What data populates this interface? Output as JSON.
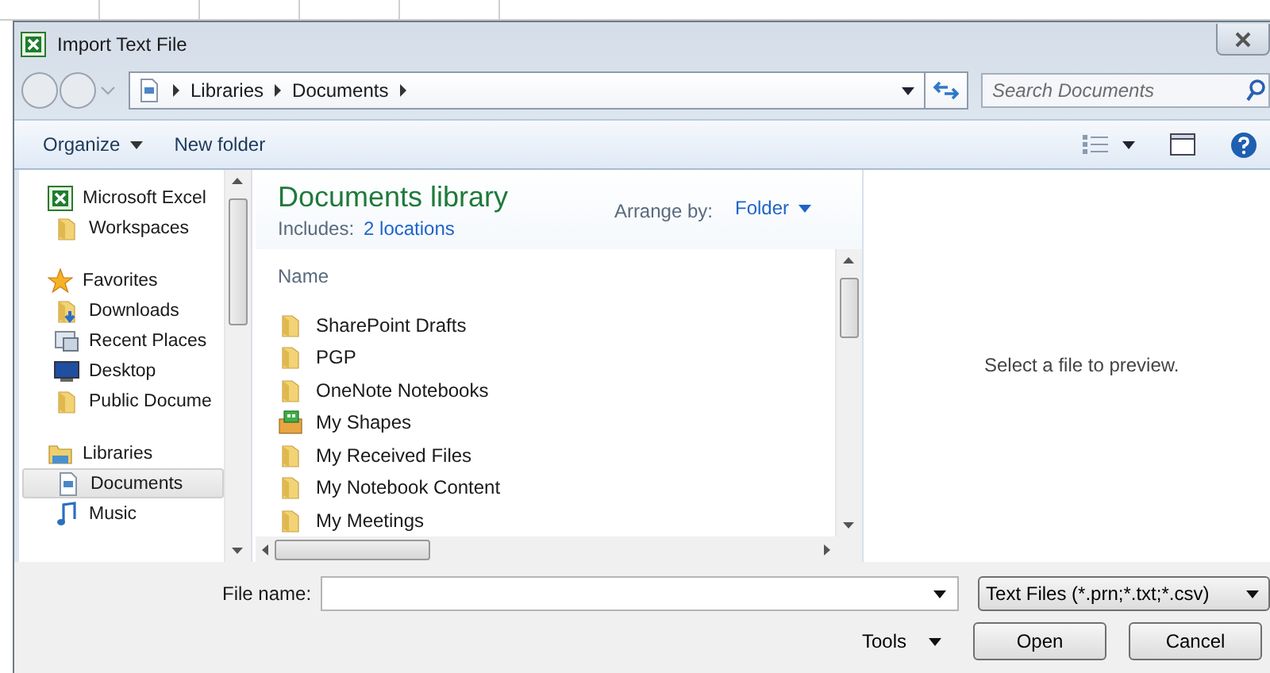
{
  "window": {
    "title": "Import Text File"
  },
  "address_bar": {
    "breadcrumbs": [
      "Libraries",
      "Documents"
    ]
  },
  "search": {
    "placeholder": "Search Documents"
  },
  "toolbar": {
    "buttons": [
      {
        "label": "Organize",
        "dropdown": true
      },
      {
        "label": "New folder",
        "dropdown": false
      }
    ]
  },
  "navigation": [
    {
      "label": "Microsoft Excel",
      "kind": "excel",
      "selected": false,
      "children": [
        {
          "label": "Workspaces",
          "kind": "folder",
          "selected": false
        }
      ]
    },
    {
      "label": "Favorites",
      "kind": "star",
      "selected": false,
      "children": [
        {
          "label": "Downloads",
          "kind": "download",
          "selected": false
        },
        {
          "label": "Recent Places",
          "kind": "recent",
          "selected": false
        },
        {
          "label": "Desktop",
          "kind": "desktop",
          "selected": false
        },
        {
          "label": "Public Docume",
          "kind": "folder",
          "selected": false
        }
      ]
    },
    {
      "label": "Libraries",
      "kind": "library",
      "selected": false,
      "children": [
        {
          "label": "Documents",
          "kind": "document",
          "selected": true
        },
        {
          "label": "Music",
          "kind": "music",
          "selected": false
        }
      ]
    }
  ],
  "library": {
    "title": "Documents library",
    "includes_label": "Includes:",
    "includes_link": "2 locations",
    "arrange_label": "Arrange by:",
    "arrange_value": "Folder"
  },
  "files": {
    "column": "Name",
    "items": [
      {
        "name": "SharePoint Drafts",
        "kind": "folder"
      },
      {
        "name": "PGP",
        "kind": "folder"
      },
      {
        "name": "OneNote Notebooks",
        "kind": "folder"
      },
      {
        "name": "My Shapes",
        "kind": "shapes"
      },
      {
        "name": "My Received Files",
        "kind": "folder"
      },
      {
        "name": "My Notebook Content",
        "kind": "folder"
      },
      {
        "name": "My Meetings",
        "kind": "folder"
      }
    ]
  },
  "preview": {
    "message": "Select a file to preview."
  },
  "file_name": {
    "label": "File name:"
  },
  "file_type": {
    "value": "Text Files (*.prn;*.txt;*.csv)"
  },
  "tools": {
    "label": "Tools"
  },
  "buttons": [
    "Open",
    "Cancel"
  ]
}
